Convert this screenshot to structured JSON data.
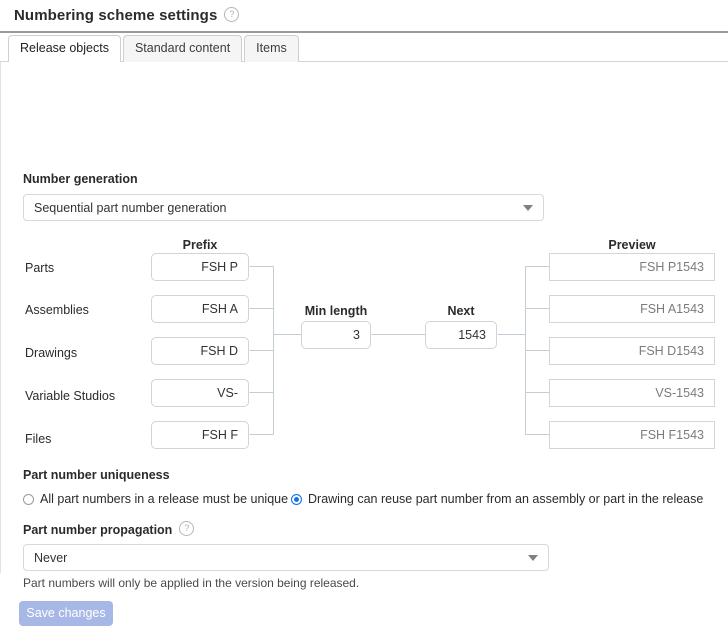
{
  "header": {
    "title": "Numbering scheme settings",
    "help_icon": "help-circle-icon",
    "help_glyph": "?"
  },
  "tabs": [
    {
      "label": "Release objects",
      "active": true
    },
    {
      "label": "Standard content",
      "active": false
    },
    {
      "label": "Items",
      "active": false
    }
  ],
  "number_generation": {
    "label": "Number generation",
    "selected": "Sequential part number generation"
  },
  "diagram": {
    "headings": {
      "prefix": "Prefix",
      "min_length": "Min length",
      "next": "Next",
      "preview": "Preview"
    },
    "rows": [
      {
        "label": "Parts",
        "prefix": "FSH P",
        "preview": "FSH P1543"
      },
      {
        "label": "Assemblies",
        "prefix": "FSH A",
        "preview": "FSH A1543"
      },
      {
        "label": "Drawings",
        "prefix": "FSH D",
        "preview": "FSH D1543"
      },
      {
        "label": "Variable Studios",
        "prefix": "VS-",
        "preview": "VS-1543"
      },
      {
        "label": "Files",
        "prefix": "FSH F",
        "preview": "FSH F1543"
      }
    ],
    "min_length": "3",
    "next": "1543"
  },
  "uniqueness": {
    "label": "Part number uniqueness",
    "options": [
      {
        "label": "All part numbers in a release must be unique",
        "selected": false
      },
      {
        "label": "Drawing can reuse part number from an assembly or part in the release",
        "selected": true
      }
    ]
  },
  "propagation": {
    "label": "Part number propagation",
    "help_glyph": "?",
    "selected": "Never",
    "hint": "Part numbers will only be applied in the version being released."
  },
  "actions": {
    "save_label": "Save changes"
  },
  "colors": {
    "accent_radio": "#1473e6",
    "save_button": "#a8b8e6",
    "field_border": "#ced4d9",
    "connector": "#c3cdd6"
  }
}
